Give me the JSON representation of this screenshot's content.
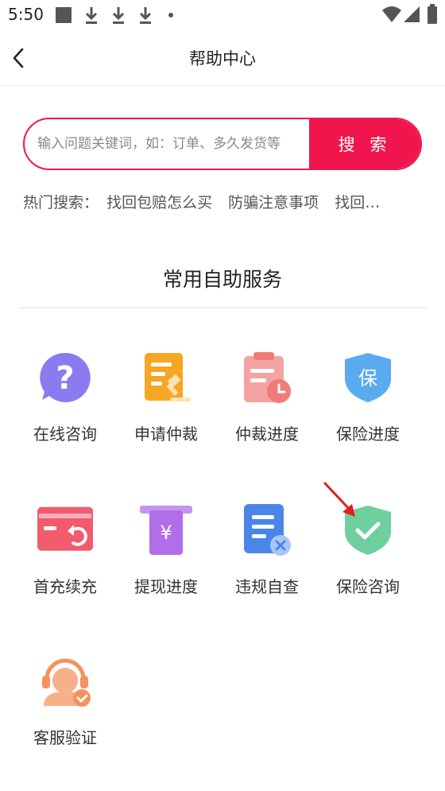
{
  "status_bar": {
    "time": "5:50"
  },
  "header": {
    "title": "帮助中心"
  },
  "search": {
    "placeholder": "输入问题关键词，如：订单、多久发货等",
    "button_label": "搜 索"
  },
  "hot_search": {
    "label": "热门搜索：",
    "items": [
      "找回包赔怎么买",
      "防骗注意事项",
      "找回…"
    ]
  },
  "section": {
    "title": "常用自助服务"
  },
  "services": [
    {
      "label": "在线咨询",
      "icon": "question-icon",
      "color": "#8a7cf0"
    },
    {
      "label": "申请仲裁",
      "icon": "arbitration-icon",
      "color": "#f6a623"
    },
    {
      "label": "仲裁进度",
      "icon": "clipboard-clock-icon",
      "color": "#f28b82"
    },
    {
      "label": "保险进度",
      "icon": "shield-bao-icon",
      "color": "#4a9ff0"
    },
    {
      "label": "首充续充",
      "icon": "card-recharge-icon",
      "color": "#f25a6e"
    },
    {
      "label": "提现进度",
      "icon": "withdraw-icon",
      "color": "#b06ee8"
    },
    {
      "label": "违规自查",
      "icon": "document-x-icon",
      "color": "#4a86e8"
    },
    {
      "label": "保险咨询",
      "icon": "shield-check-icon",
      "color": "#5cc393"
    },
    {
      "label": "客服验证",
      "icon": "customer-service-icon",
      "color": "#f5925e"
    }
  ]
}
